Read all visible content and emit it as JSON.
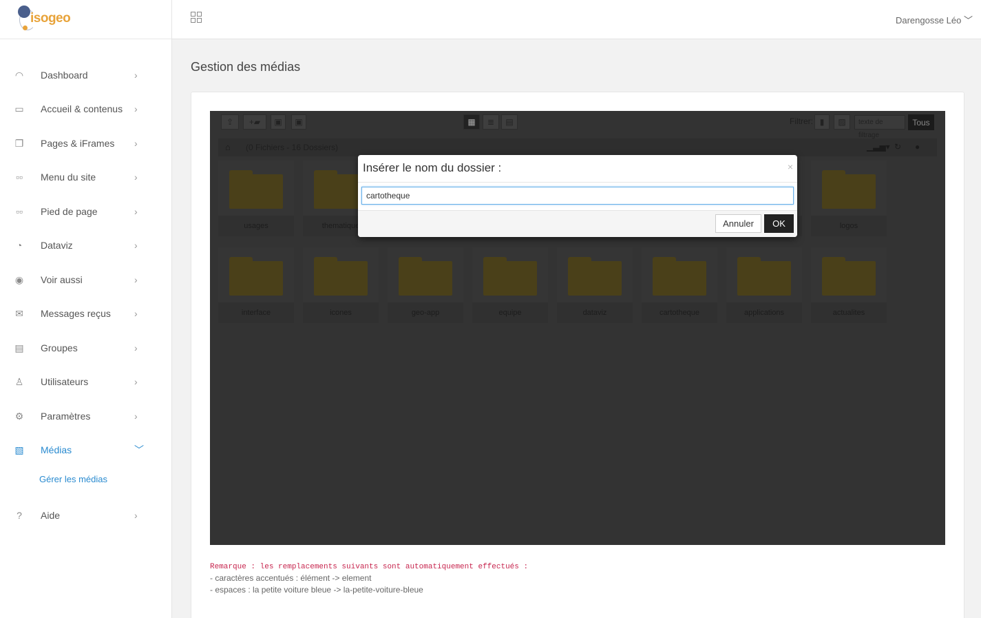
{
  "brand": {
    "name": "isogeo",
    "accent": "#e8a33a"
  },
  "sidebar": {
    "items": [
      {
        "label": "Dashboard",
        "icon": "dashboard-icon",
        "glyph": "◠"
      },
      {
        "label": "Accueil & contenus",
        "icon": "monitor-icon",
        "glyph": "▭"
      },
      {
        "label": "Pages & iFrames",
        "icon": "pages-icon",
        "glyph": "❐"
      },
      {
        "label": "Menu du site",
        "icon": "menu-icon",
        "glyph": "▫▫"
      },
      {
        "label": "Pied de page",
        "icon": "footer-icon",
        "glyph": "▫▫"
      },
      {
        "label": "Dataviz",
        "icon": "pie-chart-icon",
        "glyph": "◔"
      },
      {
        "label": "Voir aussi",
        "icon": "eye-icon",
        "glyph": "◉"
      },
      {
        "label": "Messages reçus",
        "icon": "envelope-icon",
        "glyph": "✉"
      },
      {
        "label": "Groupes",
        "icon": "id-card-icon",
        "glyph": "▤"
      },
      {
        "label": "Utilisateurs",
        "icon": "user-icon",
        "glyph": "♙"
      },
      {
        "label": "Paramètres",
        "icon": "gear-icon",
        "glyph": "⚙"
      },
      {
        "label": "Médias",
        "icon": "image-icon",
        "glyph": "▧"
      },
      {
        "label": "Aide",
        "icon": "question-icon",
        "glyph": "?"
      }
    ],
    "sub_item": "Gérer les médias",
    "active_color": "#2a8bd0"
  },
  "topbar": {
    "user": "Darengosse Léo"
  },
  "page": {
    "title": "Gestion des médias"
  },
  "filemanager": {
    "filter_label": "Filtrer:",
    "filter_placeholder": "texte de filtrage",
    "all_button": "Tous",
    "count": "(0 Fichiers - 16 Dossiers)",
    "folders_row1": [
      "usages",
      "thematique",
      "",
      "",
      "",
      "",
      "",
      "logos"
    ],
    "folders_row2": [
      "interface",
      "icones",
      "geo-app",
      "equipe",
      "dataviz",
      "cartotheque",
      "applications",
      "actualites"
    ]
  },
  "dialog": {
    "title": "Insérer le nom du dossier :",
    "close": "×",
    "value": "cartotheque",
    "cancel": "Annuler",
    "ok": "OK"
  },
  "note": {
    "heading": "Remarque : les remplacements suivants sont automatiquement effectués :",
    "line1": "- caractères accentués : élément -> element",
    "line2": "- espaces : la petite voiture bleue -> la-petite-voiture-bleue"
  }
}
